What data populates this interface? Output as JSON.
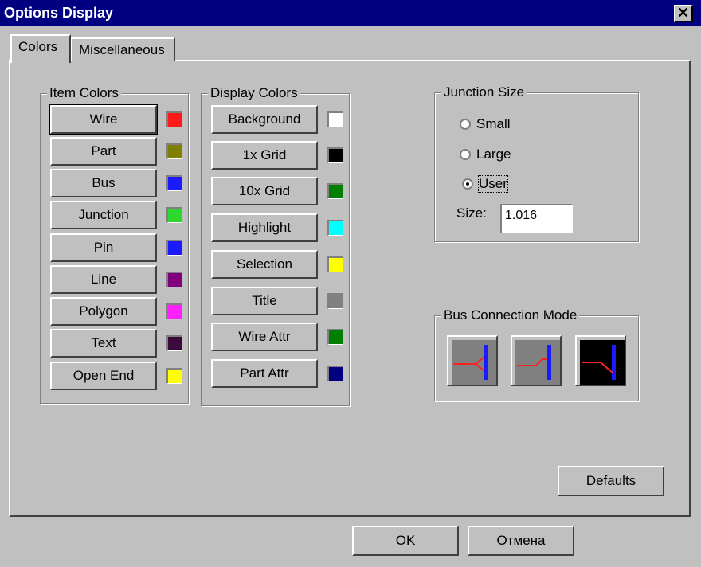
{
  "window": {
    "title": "Options Display",
    "close_label": "✕"
  },
  "tabs": [
    "Colors",
    "Miscellaneous"
  ],
  "item_colors": {
    "legend": "Item Colors",
    "items": [
      {
        "label": "Wire",
        "color": "#ff1a1a"
      },
      {
        "label": "Part",
        "color": "#808000"
      },
      {
        "label": "Bus",
        "color": "#1a1aff"
      },
      {
        "label": "Junction",
        "color": "#2bd82b"
      },
      {
        "label": "Pin",
        "color": "#1a1aff"
      },
      {
        "label": "Line",
        "color": "#800080"
      },
      {
        "label": "Polygon",
        "color": "#ff20ff"
      },
      {
        "label": "Text",
        "color": "#3a0a3a"
      },
      {
        "label": "Open End",
        "color": "#ffff00"
      }
    ]
  },
  "display_colors": {
    "legend": "Display Colors",
    "items": [
      {
        "label": "Background",
        "color": "#ffffff"
      },
      {
        "label": "1x Grid",
        "color": "#000000"
      },
      {
        "label": "10x Grid",
        "color": "#008000"
      },
      {
        "label": "Highlight",
        "color": "#00ffff"
      },
      {
        "label": "Selection",
        "color": "#ffff00"
      },
      {
        "label": "Title",
        "color": "#808080"
      },
      {
        "label": "Wire Attr",
        "color": "#008000"
      },
      {
        "label": "Part Attr",
        "color": "#000080"
      }
    ]
  },
  "junction_size": {
    "legend": "Junction Size",
    "options": [
      "Small",
      "Large",
      "User"
    ],
    "selected": "User",
    "size_label": "Size:",
    "size_value": "1.016"
  },
  "bus_connection": {
    "legend": "Bus Connection Mode",
    "modes": [
      "angled-bus-entry-icon",
      "straight-bus-entry-icon",
      "diagonal-bus-entry-icon"
    ]
  },
  "buttons": {
    "defaults": "Defaults",
    "ok": "OK",
    "cancel": "Отмена"
  }
}
